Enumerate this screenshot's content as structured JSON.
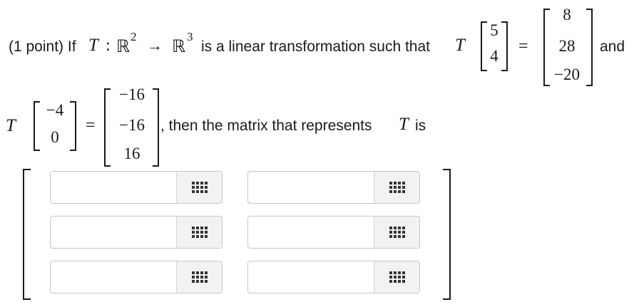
{
  "problem": {
    "points": "(1 point) If",
    "T": "T",
    "colon": ":",
    "domain": "ℝ",
    "domain_exp": "2",
    "arrow": "→",
    "codomain": "ℝ",
    "codomain_exp": "3",
    "clause": "is a linear transformation such that",
    "T2": "T",
    "and": "and",
    "T3": "T",
    "equals": "=",
    "then": ", then the matrix that represents",
    "T4": "T",
    "is": "is"
  },
  "vectors": {
    "input1": [
      "5",
      "4"
    ],
    "output1": [
      "8",
      "28",
      "−20"
    ],
    "input2": [
      "−4",
      "0"
    ],
    "output2": [
      "−16",
      "−16",
      "16"
    ]
  },
  "answer_matrix": {
    "rows": 3,
    "cols": 2,
    "cells": [
      [
        "",
        ""
      ],
      [
        "",
        ""
      ],
      [
        "",
        ""
      ]
    ],
    "palette_icon": "grid-icon"
  }
}
